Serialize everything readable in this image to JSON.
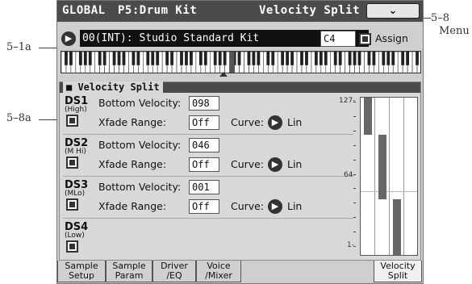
{
  "callouts": {
    "menu_num": "5–8",
    "menu_text": "Menu",
    "kit_select": "5–1a",
    "ds_group": "5–8a"
  },
  "titlebar": {
    "mode": "GLOBAL",
    "page": "P5:Drum Kit",
    "page_name": "Velocity Split",
    "menu_glyph": "⌄"
  },
  "kit": {
    "value": "00(INT): Studio Standard Kit",
    "note": "C4",
    "assign_label": "Assign"
  },
  "panel": {
    "title": "Velocity Split"
  },
  "labels": {
    "bottom_velocity": "Bottom Velocity:",
    "xfade_range": "Xfade Range:",
    "curve": "Curve:"
  },
  "ds": [
    {
      "name": "DS1",
      "sub": "(High)",
      "bottom_velocity": "098",
      "xfade": "Off",
      "curve": "Lin"
    },
    {
      "name": "DS2",
      "sub": "(M Hi)",
      "bottom_velocity": "046",
      "xfade": "Off",
      "curve": "Lin"
    },
    {
      "name": "DS3",
      "sub": "(MLo)",
      "bottom_velocity": "001",
      "xfade": "Off",
      "curve": "Lin"
    },
    {
      "name": "DS4",
      "sub": "(Low)"
    }
  ],
  "graph": {
    "scale_top": "127-",
    "scale_mid": "64-",
    "scale_bottom": "1-",
    "ranges": [
      {
        "low": 98,
        "high": 127
      },
      {
        "low": 46,
        "high": 97
      },
      {
        "low": 1,
        "high": 45
      }
    ]
  },
  "tabs": [
    {
      "line1": "Sample",
      "line2": "Setup"
    },
    {
      "line1": "Sample",
      "line2": "Param"
    },
    {
      "line1": "Driver",
      "line2": "/EQ"
    },
    {
      "line1": "Voice",
      "line2": "/Mixer"
    },
    {
      "line1": "Velocity",
      "line2": "Split"
    }
  ]
}
